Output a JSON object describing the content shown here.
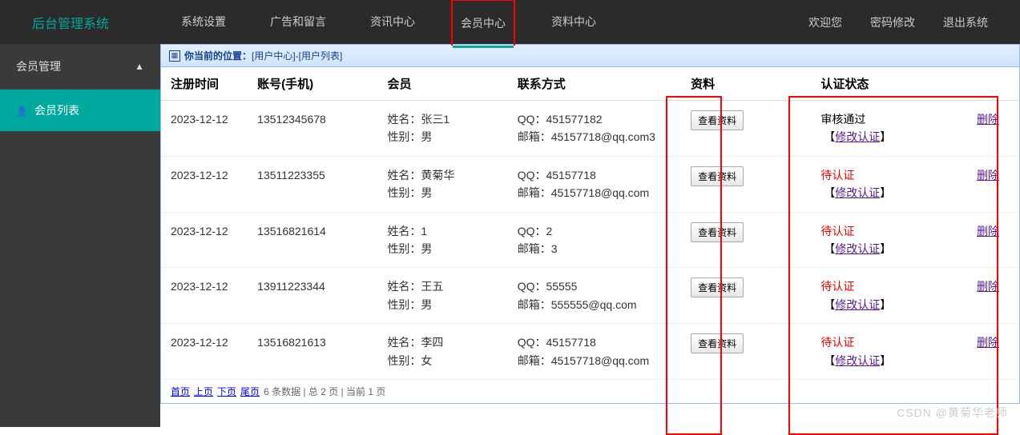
{
  "header": {
    "logo": "后台管理系统",
    "nav": [
      "系统设置",
      "广告和留言",
      "资讯中心",
      "会员中心",
      "资料中心"
    ],
    "active_index": 3,
    "right": [
      "欢迎您",
      "密码修改",
      "退出系统"
    ]
  },
  "sidebar": {
    "title": "会员管理",
    "items": [
      {
        "label": "会员列表"
      }
    ]
  },
  "breadcrumb": {
    "prefix": "你当前的位置：",
    "path": "[用户中心]-[用户列表]"
  },
  "table": {
    "headers": [
      "注册时间",
      "账号(手机)",
      "会员",
      "联系方式",
      "资料",
      "认证状态",
      ""
    ],
    "view_btn": "查看资料",
    "modify_link": "修改认证",
    "delete_link": "删除",
    "name_label": "姓名：",
    "gender_label": "性别：",
    "qq_label": "QQ：",
    "email_label": "邮箱：",
    "rows": [
      {
        "reg": "2023-12-12",
        "account": "13512345678",
        "name": "张三1",
        "gender": "男",
        "qq": "451577182",
        "email": "45157718@qq.com3",
        "status": "审核通过",
        "status_class": "pass"
      },
      {
        "reg": "2023-12-12",
        "account": "13511223355",
        "name": "黄菊华",
        "gender": "男",
        "qq": "45157718",
        "email": "45157718@qq.com",
        "status": "待认证",
        "status_class": "pending"
      },
      {
        "reg": "2023-12-12",
        "account": "13516821614",
        "name": "1",
        "gender": "男",
        "qq": "2",
        "email": "3",
        "status": "待认证",
        "status_class": "pending"
      },
      {
        "reg": "2023-12-12",
        "account": "13911223344",
        "name": "王五",
        "gender": "男",
        "qq": "55555",
        "email": "555555@qq.com",
        "status": "待认证",
        "status_class": "pending"
      },
      {
        "reg": "2023-12-12",
        "account": "13516821613",
        "name": "李四",
        "gender": "女",
        "qq": "45157718",
        "email": "45157718@qq.com",
        "status": "待认证",
        "status_class": "pending"
      }
    ]
  },
  "pagination": {
    "links": [
      "首页",
      "上页",
      "下页",
      "尾页"
    ],
    "info": "6 条数据 | 总 2 页 | 当前 1 页"
  },
  "watermark": "CSDN @黄菊华老师"
}
